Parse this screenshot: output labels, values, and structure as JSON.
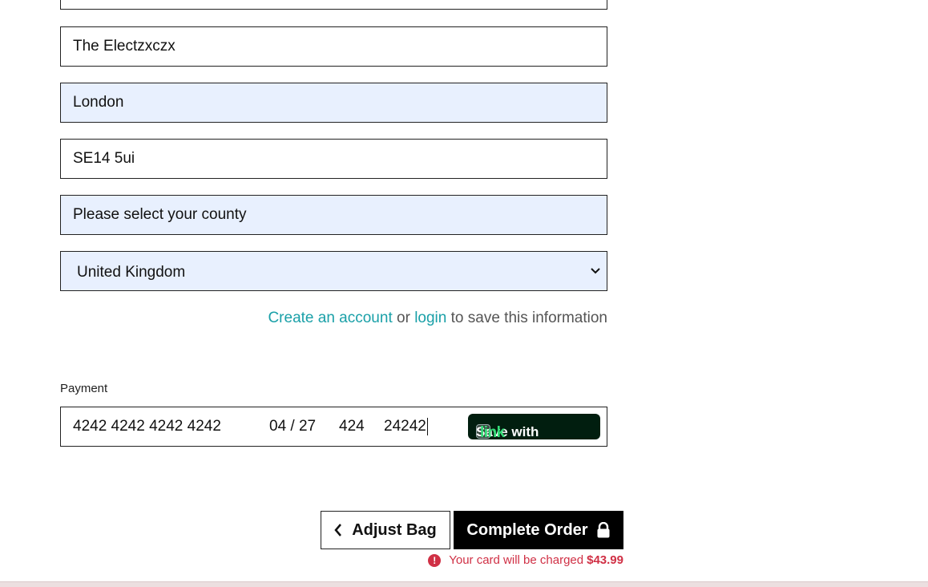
{
  "form": {
    "address_line_1": "",
    "address_line_2": "The Electzxczx",
    "city": "London",
    "postcode": "SE14 5ui",
    "county_placeholder": "Please select your county",
    "country_selected": "United Kingdom"
  },
  "account_prompt": {
    "create_link": "Create an account",
    "or_text": "or",
    "login_link": "login",
    "suffix": "to save this information"
  },
  "payment": {
    "label": "Payment",
    "card_number": "4242 4242 4242 4242",
    "expiry": "04 / 27",
    "cvc": "424",
    "postal": "24242",
    "save_with": "Save with",
    "link_brand": "link"
  },
  "actions": {
    "adjust_label": "Adjust Bag",
    "complete_label": "Complete Order"
  },
  "charge_notice": {
    "text": "Your card will be charged",
    "amount": "$43.99"
  },
  "icons": {
    "chevron_down": "chevron-down-icon",
    "chevron_left": "chevron-left-icon",
    "lock": "lock-icon",
    "alert": "alert-icon"
  },
  "colors": {
    "link": "#1aa0a8",
    "autofill": "#e8f0fe",
    "error": "#d03045",
    "link_brand": "#33dd77",
    "link_button_bg": "#011e0f"
  }
}
